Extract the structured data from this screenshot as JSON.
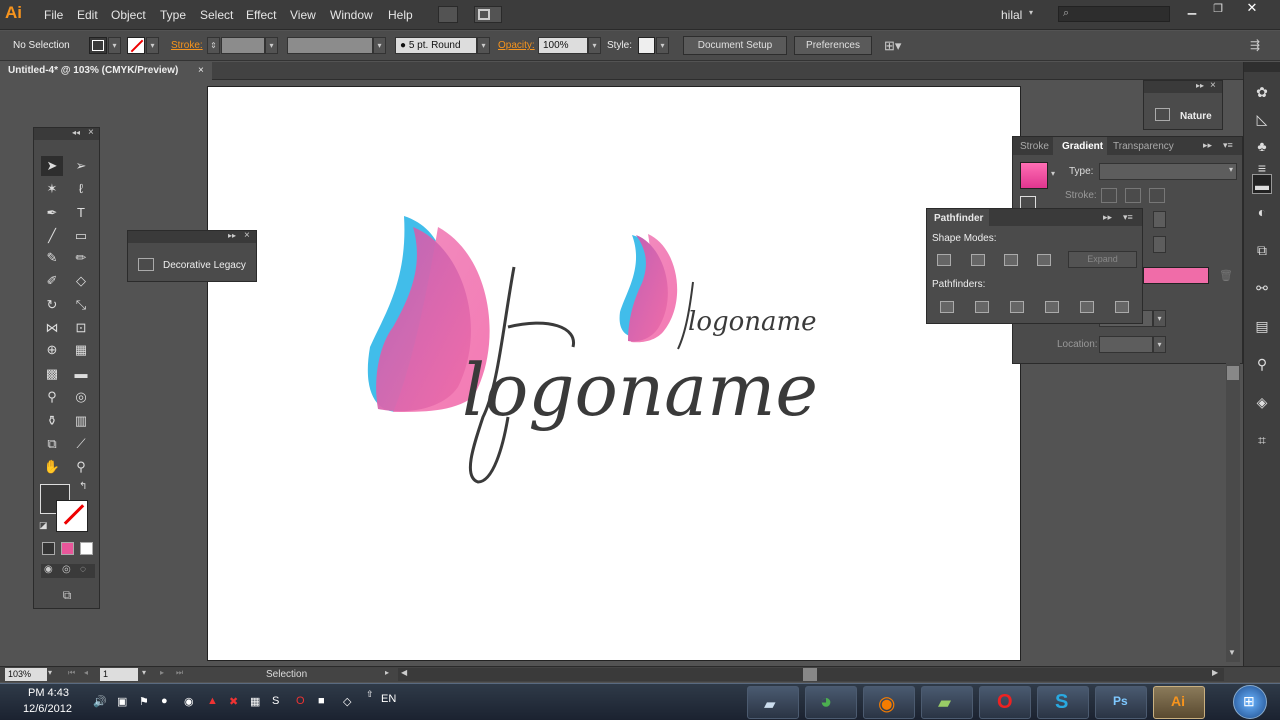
{
  "app": {
    "logo": "Ai",
    "user": "hilal"
  },
  "menu": [
    "File",
    "Edit",
    "Object",
    "Type",
    "Select",
    "Effect",
    "View",
    "Window",
    "Help"
  ],
  "control_bar": {
    "selection": "No Selection",
    "stroke_label": "Stroke:",
    "brush": "5 pt. Round",
    "opacity_label": "Opacity:",
    "opacity_value": "100%",
    "style_label": "Style:",
    "document_setup": "Document Setup",
    "preferences": "Preferences"
  },
  "document_tab": {
    "title": "Untitled-4* @ 103% (CMYK/Preview)",
    "close": "×"
  },
  "artwork": {
    "large_text": "logoname",
    "small_text": "logoname"
  },
  "decorative_panel": {
    "item": "Decorative Legacy"
  },
  "nature_panel": {
    "item": "Nature"
  },
  "gradient_panel": {
    "tabs": [
      "Stroke",
      "Gradient",
      "Transparency"
    ],
    "type_label": "Type:",
    "stroke_label": "Stroke:",
    "location_label": "Location:"
  },
  "pathfinder_panel": {
    "title": "Pathfinder",
    "shape_modes": "Shape Modes:",
    "expand": "Expand",
    "pathfinders": "Pathfinders:"
  },
  "status_bar": {
    "zoom": "103%",
    "page": "1",
    "tool": "Selection"
  },
  "taskbar": {
    "time": "PM 4:43",
    "date": "12/6/2012",
    "lang": "EN"
  },
  "colors": {
    "accent_pink": "#e8569a",
    "accent_blue": "#3fbdea",
    "stroke_label": "#f7941d"
  }
}
